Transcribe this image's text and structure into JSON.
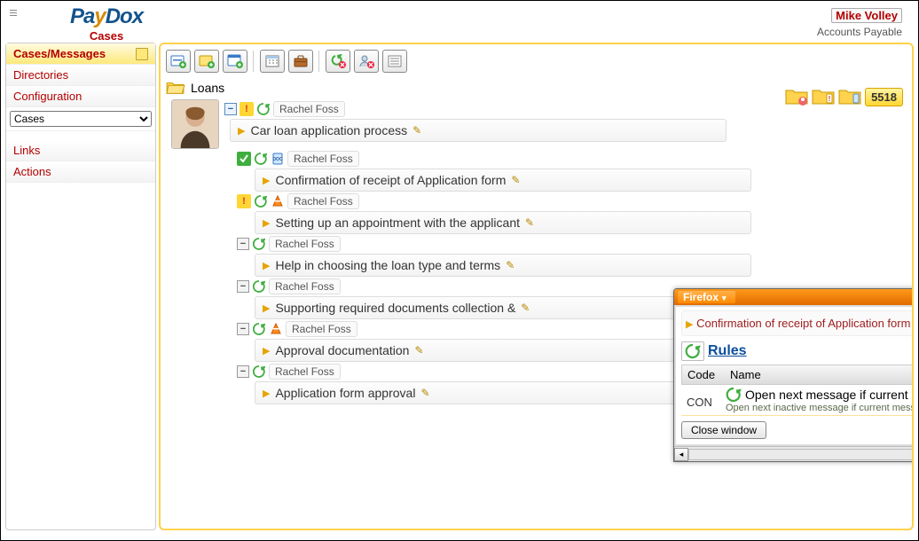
{
  "app": {
    "logo_main": "PayDox",
    "logo_sub": "Cases"
  },
  "user": {
    "name": "Mike Volley",
    "role": "Accounts Payable"
  },
  "sidebar": {
    "items": [
      {
        "label": "Cases/Messages"
      },
      {
        "label": "Directories"
      },
      {
        "label": "Configuration"
      }
    ],
    "select_value": "Cases",
    "links_label": "Links",
    "actions_label": "Actions"
  },
  "breadcrumb": {
    "folder": "Loans"
  },
  "count_badge": "5518",
  "root_case": {
    "author": "Rachel Foss",
    "title": "Car loan application process"
  },
  "sub_cases": [
    {
      "author": "Rachel Foss",
      "title": "Confirmation of receipt of Application form"
    },
    {
      "author": "Rachel Foss",
      "title": "Setting up an appointment with the applicant"
    },
    {
      "author": "Rachel Foss",
      "title": "Help in choosing the loan type and terms"
    },
    {
      "author": "Rachel Foss",
      "title": "Supporting required documents collection & "
    },
    {
      "author": "Rachel Foss",
      "title": "Approval documentation"
    },
    {
      "author": "Rachel Foss",
      "title": "Application form approval"
    }
  ],
  "popup": {
    "window_title": "Firefox",
    "link_text": "Confirmation of receipt of Application form",
    "rules_label": "Rules",
    "table_headers": {
      "code": "Code",
      "name": "Name"
    },
    "rule": {
      "code": "CON",
      "name": "Open next message if current message closed",
      "desc": "Open next inactive message if current message closed"
    },
    "close_btn": "Close window"
  }
}
